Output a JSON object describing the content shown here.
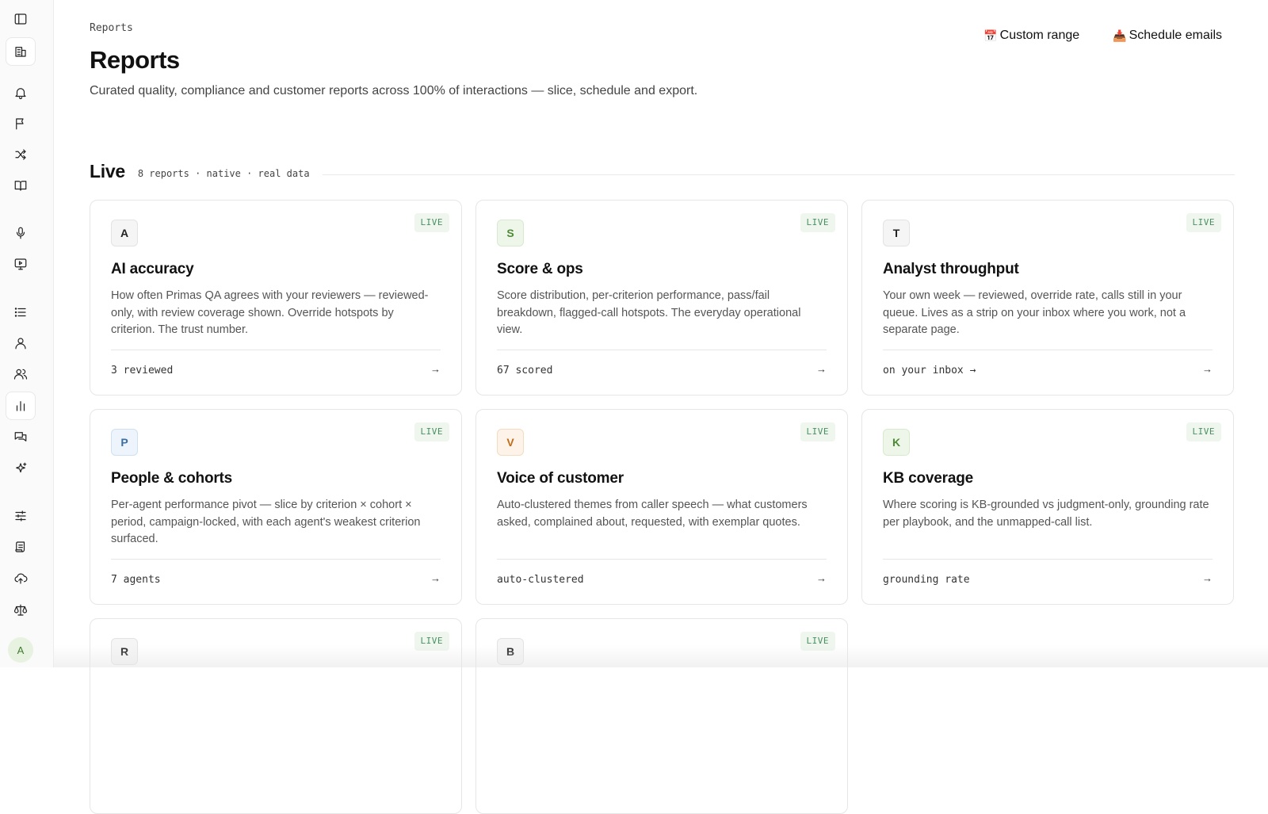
{
  "sidebar": {
    "icons": [
      "panel-toggle-icon",
      "building-icon",
      "bell-icon",
      "flag-icon",
      "shuffle-icon",
      "book-icon",
      "mic-icon",
      "monitor-icon",
      "list-icon",
      "user-icon",
      "users-icon",
      "bar-chart-icon",
      "chat-icon",
      "sparkle-icon",
      "sliders-icon",
      "scroll-icon",
      "cloud-upload-icon",
      "scale-icon"
    ],
    "active": [
      "building-icon",
      "bar-chart-icon"
    ],
    "avatar_initial": "A"
  },
  "header": {
    "breadcrumb": "Reports",
    "title": "Reports",
    "subtitle": "Curated quality, compliance and customer reports across 100% of interactions — slice, schedule and export.",
    "actions": [
      {
        "emoji": "📅",
        "label": "Custom range"
      },
      {
        "emoji": "📥",
        "label": "Schedule emails"
      }
    ]
  },
  "section": {
    "title": "Live",
    "meta": "8 reports · native · real data"
  },
  "cards": [
    {
      "letter": "A",
      "letter_bg": "#f5f5f5",
      "letter_border": "#e3e3e3",
      "letter_color": "#222222",
      "badge": "LIVE",
      "title": "AI accuracy",
      "desc": "How often Primas QA agrees with your reviewers — reviewed-only, with review coverage shown. Override hotspots by criterion. The trust number.",
      "stat": "3 reviewed",
      "arrow": "→"
    },
    {
      "letter": "S",
      "letter_bg": "#eef6e9",
      "letter_border": "#d8eacd",
      "letter_color": "#4d8a35",
      "badge": "LIVE",
      "title": "Score & ops",
      "desc": "Score distribution, per-criterion performance, pass/fail breakdown, flagged-call hotspots. The everyday operational view.",
      "stat": "67 scored",
      "arrow": "→"
    },
    {
      "letter": "T",
      "letter_bg": "#f5f5f5",
      "letter_border": "#e3e3e3",
      "letter_color": "#222222",
      "badge": "LIVE",
      "title": "Analyst throughput",
      "desc": "Your own week — reviewed, override rate, calls still in your queue. Lives as a strip on your inbox where you work, not a separate page.",
      "stat": "on your inbox →",
      "arrow": "→"
    },
    {
      "letter": "P",
      "letter_bg": "#eef4fb",
      "letter_border": "#cfe0f2",
      "letter_color": "#3b6ea3",
      "badge": "LIVE",
      "title": "People & cohorts",
      "desc": "Per-agent performance pivot — slice by criterion × cohort × period, campaign-locked, with each agent's weakest criterion surfaced.",
      "stat": "7 agents",
      "arrow": "→"
    },
    {
      "letter": "V",
      "letter_bg": "#fdf3e8",
      "letter_border": "#f3dcc0",
      "letter_color": "#c06b17",
      "badge": "LIVE",
      "title": "Voice of customer",
      "desc": "Auto-clustered themes from caller speech — what customers asked, complained about, requested, with exemplar quotes.",
      "stat": "auto-clustered",
      "arrow": "→"
    },
    {
      "letter": "K",
      "letter_bg": "#eef6e9",
      "letter_border": "#d8eacd",
      "letter_color": "#4d8a35",
      "badge": "LIVE",
      "title": "KB coverage",
      "desc": "Where scoring is KB-grounded vs judgment-only, grounding rate per playbook, and the unmapped-call list.",
      "stat": "grounding rate",
      "arrow": "→"
    },
    {
      "letter": "R",
      "letter_bg": "#f5f5f5",
      "letter_border": "#e3e3e3",
      "letter_color": "#222222",
      "badge": "LIVE",
      "title": "",
      "desc": "",
      "stat": "",
      "arrow": ""
    },
    {
      "letter": "B",
      "letter_bg": "#f5f5f5",
      "letter_border": "#e3e3e3",
      "letter_color": "#222222",
      "badge": "LIVE",
      "title": "",
      "desc": "",
      "stat": "",
      "arrow": ""
    }
  ]
}
